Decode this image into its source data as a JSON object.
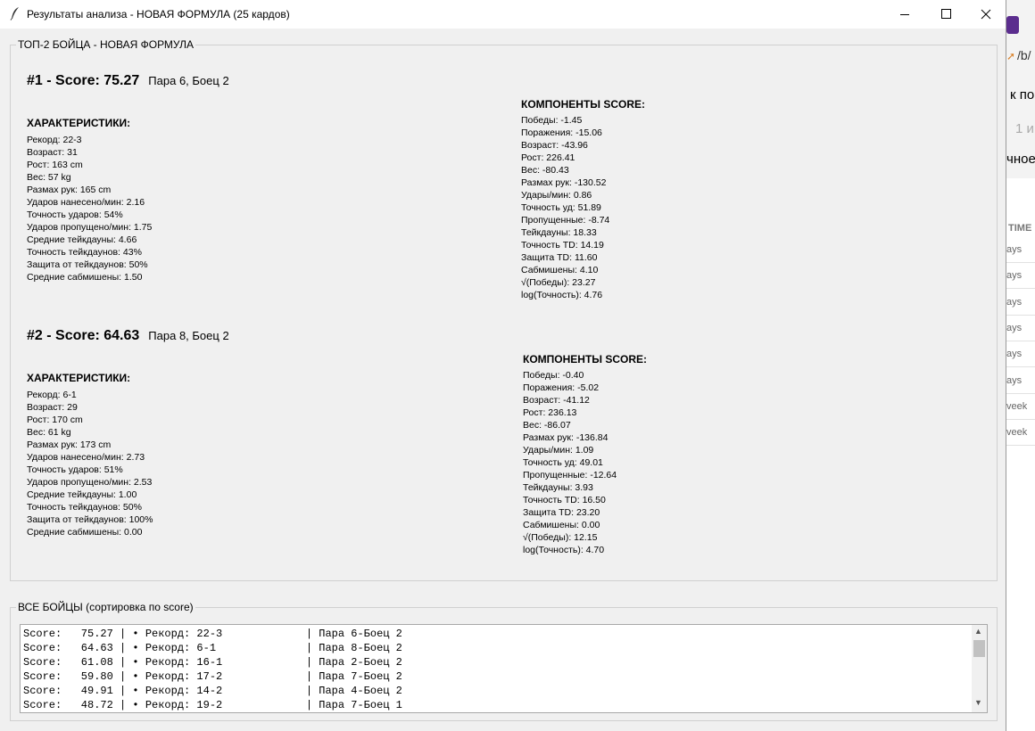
{
  "window": {
    "title": "Результаты анализа - НОВАЯ ФОРМУЛА (25 кардов)",
    "minimize_icon": "minimize-icon",
    "maximize_icon": "maximize-icon",
    "close_icon": "close-icon"
  },
  "top": {
    "legend": "ТОП-2 БОЙЦА - НОВАЯ ФОРМУЛА",
    "fighters": [
      {
        "title": "#1 - Score: 75.27",
        "subtitle": "Пара 6, Боец 2",
        "stats_header": "ХАРАКТЕРИСТИКИ:",
        "stats": [
          "Рекорд: 22-3",
          "Возраст: 31",
          "Рост: 163 cm",
          "Вес: 57 kg",
          "Размах рук: 165 cm",
          "Ударов нанесено/мин: 2.16",
          "Точность ударов: 54%",
          "Ударов пропущено/мин: 1.75",
          "Средние тейкдауны: 4.66",
          "Точность тейкдаунов: 43%",
          "Защита от тейкдаунов: 50%",
          "Средние сабмишены: 1.50"
        ],
        "comp_header": "КОМПОНЕНТЫ SCORE:",
        "components": [
          "Победы: -1.45",
          "Поражения: -15.06",
          "Возраст: -43.96",
          "Рост: 226.41",
          "Вес: -80.43",
          "Размах рук: -130.52",
          "Удары/мин: 0.86",
          "Точность уд: 51.89",
          "Пропущенные: -8.74",
          "Тейкдауны: 18.33",
          "Точность TD: 14.19",
          "Защита TD: 11.60",
          "Сабмишены: 4.10",
          "√(Победы): 23.27",
          "log(Точность): 4.76"
        ]
      },
      {
        "title": "#2 - Score: 64.63",
        "subtitle": "Пара 8, Боец 2",
        "stats_header": "ХАРАКТЕРИСТИКИ:",
        "stats": [
          "Рекорд: 6-1",
          "Возраст: 29",
          "Рост: 170 cm",
          "Вес: 61 kg",
          "Размах рук: 173 cm",
          "Ударов нанесено/мин: 2.73",
          "Точность ударов: 51%",
          "Ударов пропущено/мин: 2.53",
          "Средние тейкдауны: 1.00",
          "Точность тейкдаунов: 50%",
          "Защита от тейкдаунов: 100%",
          "Средние сабмишены: 0.00"
        ],
        "comp_header": "КОМПОНЕНТЫ SCORE:",
        "components": [
          "Победы: -0.40",
          "Поражения: -5.02",
          "Возраст: -41.12",
          "Рост: 236.13",
          "Вес: -86.07",
          "Размах рук: -136.84",
          "Удары/мин: 1.09",
          "Точность уд: 49.01",
          "Пропущенные: -12.64",
          "Тейкдауны: 3.93",
          "Точность TD: 16.50",
          "Защита TD: 23.20",
          "Сабмишены: 0.00",
          "√(Победы): 12.15",
          "log(Точность): 4.70"
        ]
      }
    ]
  },
  "all": {
    "legend": "ВСЕ БОЙЦЫ (сортировка по score)",
    "rows": [
      "Score:   75.27 | • Рекорд: 22-3             | Пара 6-Боец 2",
      "Score:   64.63 | • Рекорд: 6-1              | Пара 8-Боец 2",
      "Score:   61.08 | • Рекорд: 16-1             | Пара 2-Боец 2",
      "Score:   59.80 | • Рекорд: 17-2             | Пара 7-Боец 2",
      "Score:   49.91 | • Рекорд: 14-2             | Пара 4-Боец 2",
      "Score:   48.72 | • Рекорд: 19-2             | Пара 7-Боец 1"
    ]
  },
  "background": {
    "path": "/b/",
    "heading": "к по с",
    "grey": "1 и",
    "text": "чное",
    "col_header": "TIME",
    "cells": [
      "ays",
      "ays",
      "ays",
      "ays",
      "ays",
      "ays",
      "veek",
      "veek"
    ]
  }
}
